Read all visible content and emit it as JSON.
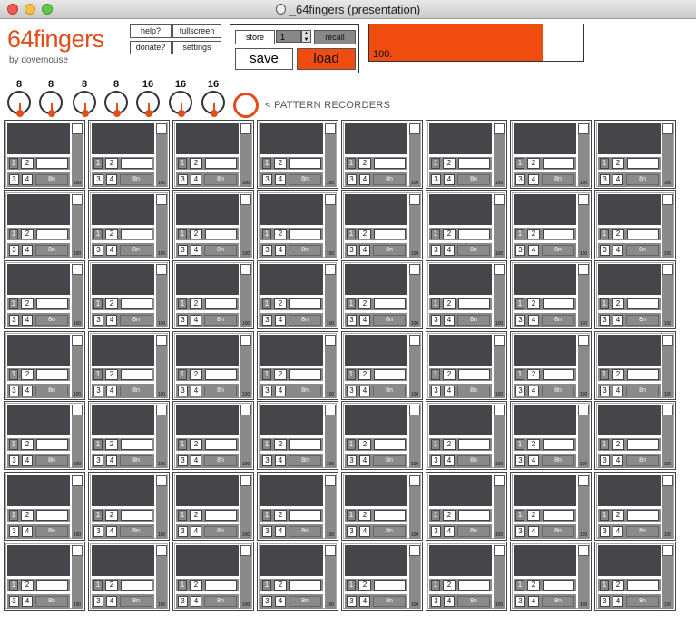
{
  "window": {
    "title": "_64fingers (presentation)"
  },
  "app": {
    "logo": "64fingers",
    "byline": "by dovemouse"
  },
  "top_buttons": {
    "help": "help?",
    "fullscreen": "fullscreen",
    "donate": "donate?",
    "settings": "settings"
  },
  "preset": {
    "store": "store",
    "number": "1",
    "recall": "recall",
    "save": "save",
    "load": "load"
  },
  "meter": {
    "value_text": "100.",
    "fill_fraction": 0.81,
    "fill_color": "#f14c0f"
  },
  "knobs": [
    "8",
    "8",
    "8",
    "8",
    "16",
    "16",
    "16"
  ],
  "pattern_recorders_label": "< PATTERN RECORDERS",
  "colors": {
    "accent": "#e04e1c",
    "pad": "#45454a",
    "control_gray": "#8a8a8a"
  },
  "grid": {
    "rows": 7,
    "columns": 8
  },
  "cell_template": {
    "btn1": "1",
    "btn2": "2",
    "btn3": "3",
    "btn4": "4",
    "rate": "8n",
    "fader_value": "100"
  }
}
